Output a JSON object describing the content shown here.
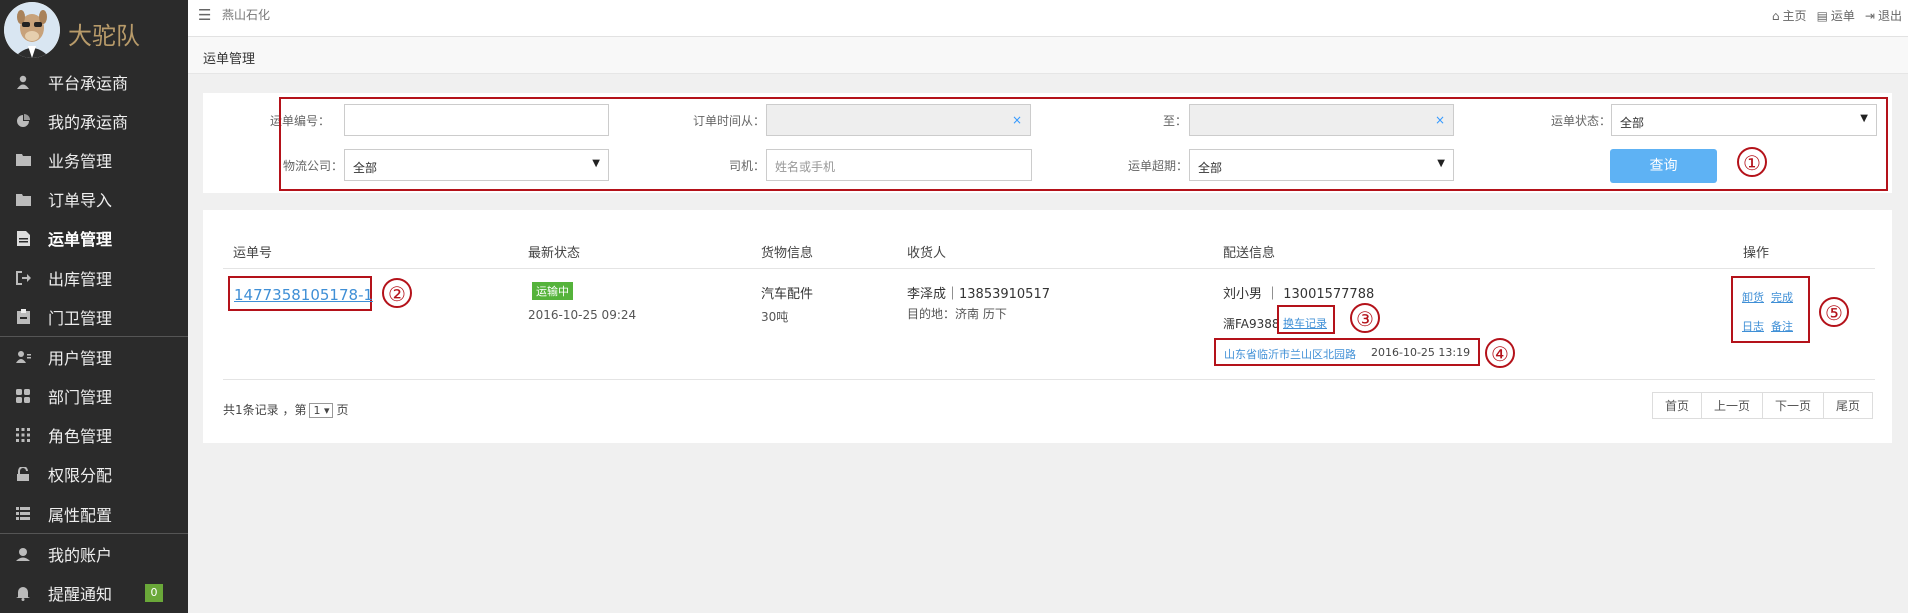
{
  "brand": {
    "name": "大驼队"
  },
  "sidebar": {
    "items": [
      {
        "label": "平台承运商",
        "icon": "user-icon"
      },
      {
        "label": "我的承运商",
        "icon": "pie-chart-icon"
      },
      {
        "label": "业务管理",
        "icon": "folder-icon"
      },
      {
        "label": "订单导入",
        "icon": "folder-icon"
      },
      {
        "label": "运单管理",
        "icon": "file-icon",
        "active": true
      },
      {
        "label": "出库管理",
        "icon": "signout-icon"
      },
      {
        "label": "门卫管理",
        "icon": "clipboard-icon"
      },
      {
        "label": "用户管理",
        "icon": "user-card-icon"
      },
      {
        "label": "部门管理",
        "icon": "grid-icon"
      },
      {
        "label": "角色管理",
        "icon": "dots-grid-icon"
      },
      {
        "label": "权限分配",
        "icon": "lock-icon"
      },
      {
        "label": "属性配置",
        "icon": "list-icon"
      },
      {
        "label": "我的账户",
        "icon": "account-icon"
      },
      {
        "label": "提醒通知",
        "icon": "bell-icon",
        "badge": "0"
      }
    ]
  },
  "topbar": {
    "company": "燕山石化",
    "links": {
      "home": "主页",
      "waybill": "运单",
      "logout": "退出"
    }
  },
  "page": {
    "title": "运单管理"
  },
  "filter": {
    "waybill_no_label": "运单编号：",
    "order_time_from_label": "订单时间从：",
    "to_label": "至：",
    "status_label": "运单状态：",
    "status_value": "全部",
    "logistics_label": "物流公司：",
    "logistics_value": "全部",
    "driver_label": "司机：",
    "driver_placeholder": "姓名或手机",
    "overdue_label": "运单超期：",
    "overdue_value": "全部",
    "clear_symbol": "×",
    "query_button": "查询"
  },
  "table": {
    "headers": {
      "waybill": "运单号",
      "status": "最新状态",
      "goods": "货物信息",
      "receiver": "收货人",
      "delivery": "配送信息",
      "ops": "操作"
    },
    "row": {
      "waybill_no": "1477358105178-1",
      "status_tag": "运输中",
      "status_time": "2016-10-25 09:24",
      "goods_name": "汽车配件",
      "goods_qty": "30吨",
      "receiver": "李泽成｜13853910517",
      "destination": "目的地：济南 历下",
      "driver": "刘小男 ｜ 13001577788",
      "plate": "濡FA9388",
      "change_car": "换车记录",
      "location": "山东省临沂市兰山区北园路",
      "location_time": "2016-10-25 13:19",
      "ops": {
        "unload": "卸货",
        "complete": "完成",
        "log": "日志",
        "note": "备注"
      }
    }
  },
  "footer": {
    "total_prefix": "共1条记录 ，第",
    "page_value": "1",
    "page_suffix": "页",
    "first": "首页",
    "prev": "上一页",
    "next": "下一页",
    "last": "尾页"
  },
  "annotations": [
    "①",
    "②",
    "③",
    "④",
    "⑤"
  ],
  "colors": {
    "sidebar": "#2b2b2b",
    "annotation_red": "#b4121a",
    "link": "#3f8fd6",
    "query_button": "#5eb2f4",
    "status_green": "#55b33b",
    "badge_green": "#6aa839"
  }
}
